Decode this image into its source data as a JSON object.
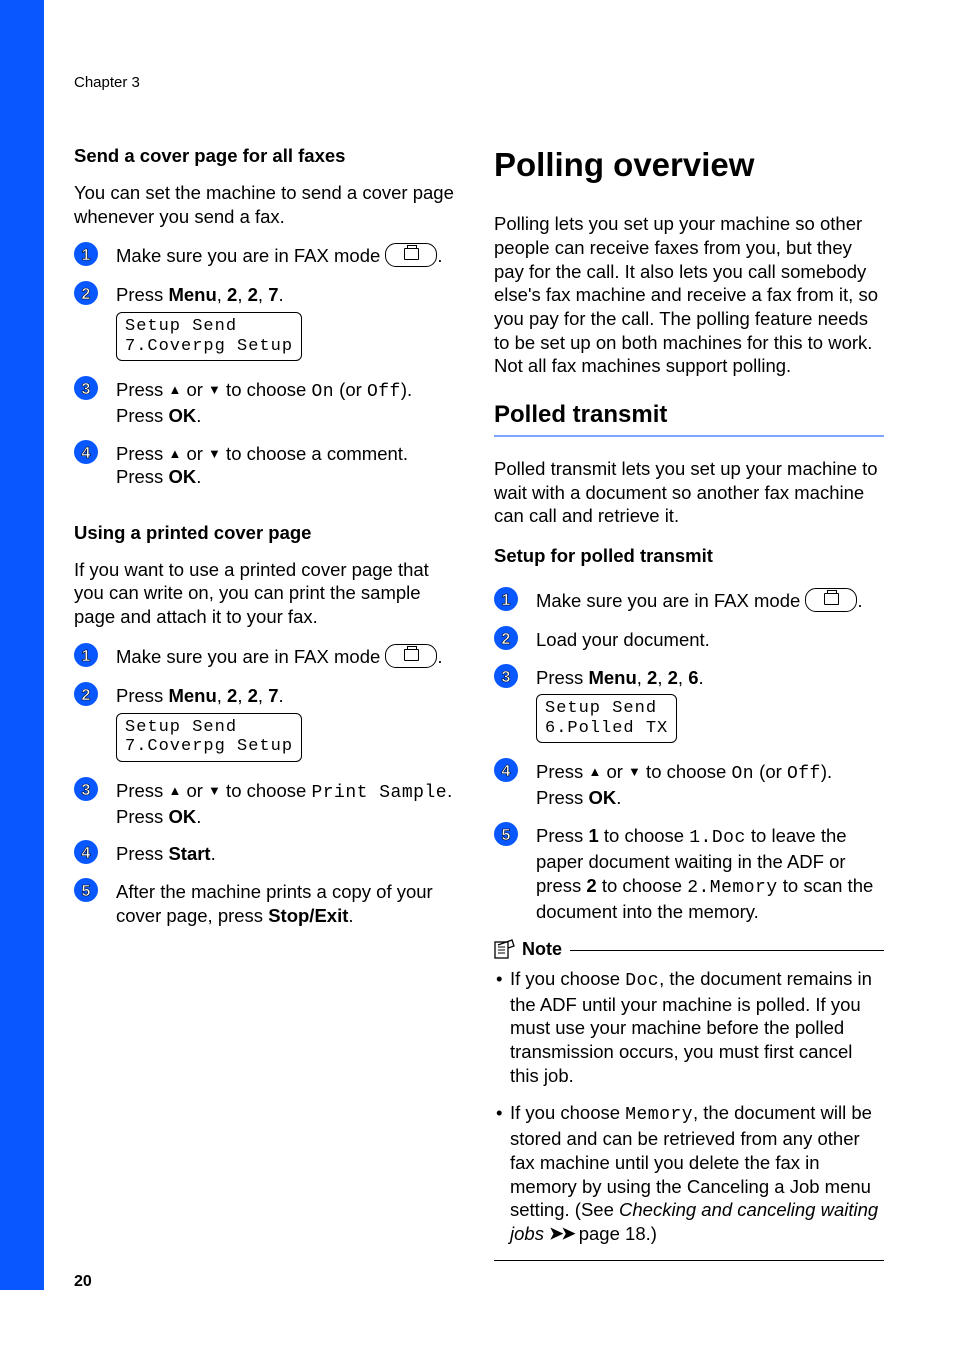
{
  "header": {
    "chapter": "Chapter 3"
  },
  "left": {
    "h_cover_all": "Send a cover page for all faxes",
    "p_cover_all": "You can set the machine to send a cover page whenever you send a fax.",
    "steps_a": {
      "s1": "Make sure you are in FAX mode ",
      "s1_end": ".",
      "s2_a": "Press ",
      "s2_menu": "Menu",
      "s2_b": ", ",
      "s2_2a": "2",
      "s2_c": ", ",
      "s2_2b": "2",
      "s2_d": ", ",
      "s2_7": "7",
      "s2_e": ".",
      "lcd_a1": "Setup Send",
      "lcd_a2": "7.Coverpg Setup",
      "s3_a": "Press ",
      "s3_up": "a",
      "s3_b": " or ",
      "s3_dn": "b",
      "s3_c": " to choose ",
      "s3_on": "On",
      "s3_d": " (or ",
      "s3_off": "Off",
      "s3_e": ").",
      "s3_f": "Press ",
      "s3_ok": "OK",
      "s3_g": ".",
      "s4_a": "Press ",
      "s4_up": "a",
      "s4_b": " or ",
      "s4_dn": "b",
      "s4_c": " to choose a comment.",
      "s4_d": "Press ",
      "s4_ok": "OK",
      "s4_e": "."
    },
    "h_printed": "Using a printed cover page",
    "p_printed": "If you want to use a printed cover page that you can write on, you can print the sample page and attach it to your fax.",
    "steps_b": {
      "s1": "Make sure you are in FAX mode ",
      "s1_end": ".",
      "s2_a": "Press ",
      "s2_menu": "Menu",
      "s2_b": ", ",
      "s2_2a": "2",
      "s2_c": ", ",
      "s2_2b": "2",
      "s2_d": ", ",
      "s2_7": "7",
      "s2_e": ".",
      "lcd_b1": "Setup Send",
      "lcd_b2": "7.Coverpg Setup",
      "s3_a": "Press ",
      "s3_up": "a",
      "s3_b": " or ",
      "s3_dn": "b",
      "s3_c": " to choose ",
      "s3_ps": "Print Sample",
      "s3_d": ".",
      "s3_e": "Press ",
      "s3_ok": "OK",
      "s3_f": ".",
      "s4_a": "Press ",
      "s4_start": "Start",
      "s4_b": ".",
      "s5_a": "After the machine prints a copy of your cover page, press ",
      "s5_stop": "Stop/Exit",
      "s5_b": "."
    }
  },
  "right": {
    "h1": "Polling overview",
    "p1": "Polling lets you set up your machine so other people can receive faxes from you, but they pay for the call. It also lets you call somebody else's fax machine and receive a fax from it, so you pay for the call. The polling feature needs to be set up on both machines for this to work. Not all fax machines support polling.",
    "h2": "Polled transmit",
    "p2": "Polled transmit lets you set up your machine to wait with a document so another fax machine can call and retrieve it.",
    "h3": "Setup for polled transmit",
    "steps": {
      "s1": "Make sure you are in FAX mode ",
      "s1_end": ".",
      "s2": "Load your document.",
      "s3_a": "Press ",
      "s3_menu": "Menu",
      "s3_b": ", ",
      "s3_2a": "2",
      "s3_c": ", ",
      "s3_2b": "2",
      "s3_d": ", ",
      "s3_6": "6",
      "s3_e": ".",
      "lcd1": "Setup Send",
      "lcd2": "6.Polled TX",
      "s4_a": "Press ",
      "s4_up": "a",
      "s4_b": " or ",
      "s4_dn": "b",
      "s4_c": " to choose ",
      "s4_on": "On",
      "s4_d": " (or ",
      "s4_off": "Off",
      "s4_e": ").",
      "s4_f": "Press ",
      "s4_ok": "OK",
      "s4_g": ".",
      "s5_a": "Press ",
      "s5_1": "1",
      "s5_b": " to choose ",
      "s5_1doc": "1.Doc",
      "s5_c": " to leave the paper document waiting in the ADF or press ",
      "s5_2": "2",
      "s5_d": " to choose ",
      "s5_2mem": "2.Memory",
      "s5_e": " to scan the document into the memory."
    },
    "note_label": "Note",
    "note1_a": "If you choose ",
    "note1_doc": "Doc",
    "note1_b": ", the document remains in the ADF until your machine is polled. If you must use your machine before the polled transmission occurs, you must first cancel this job.",
    "note2_a": "If you choose ",
    "note2_mem": "Memory",
    "note2_b": ", the document will be stored and can be retrieved from any other fax machine until you delete the fax in memory by using the Canceling a Job menu setting. (See ",
    "note2_link": "Checking and canceling waiting jobs",
    "note2_c": " ",
    "note2_page": " page 18.)"
  },
  "pagenum": "20"
}
